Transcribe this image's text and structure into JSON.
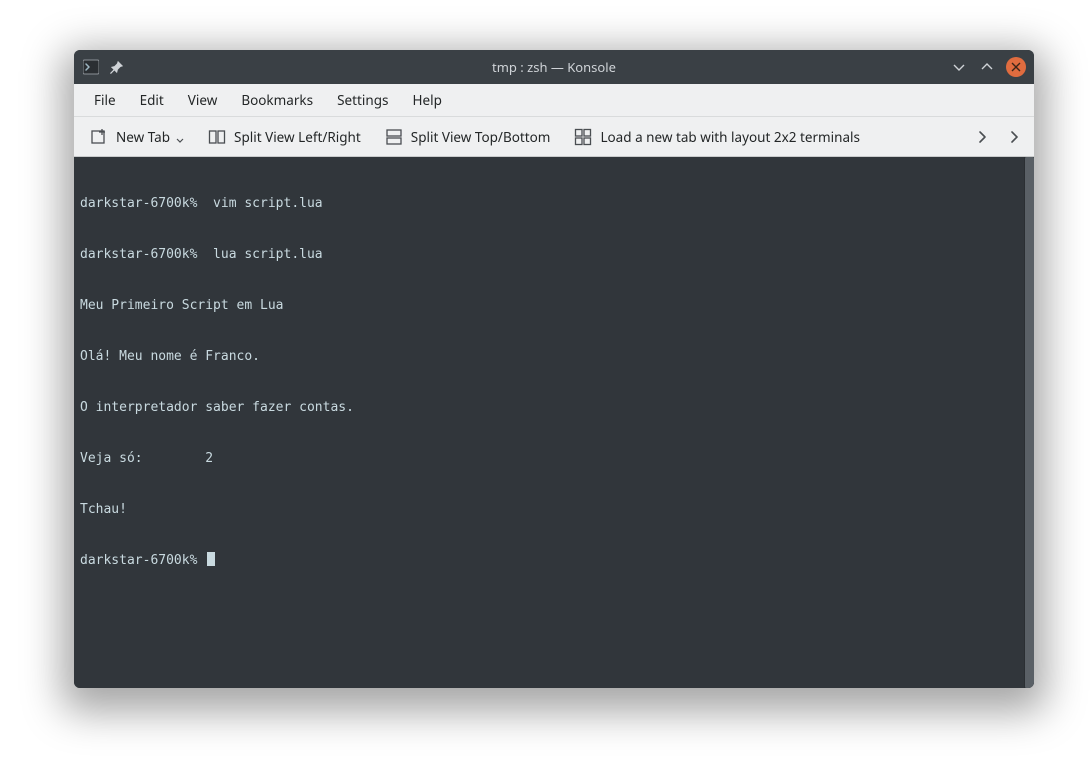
{
  "window": {
    "title": "tmp : zsh — Konsole"
  },
  "menubar": {
    "items": [
      "File",
      "Edit",
      "View",
      "Bookmarks",
      "Settings",
      "Help"
    ]
  },
  "toolbar": {
    "new_tab": "New Tab",
    "split_lr": "Split View Left/Right",
    "split_tb": "Split View Top/Bottom",
    "load_layout": "Load a new tab with layout 2x2 terminals"
  },
  "terminal": {
    "lines": [
      "darkstar-6700k%  vim script.lua",
      "darkstar-6700k%  lua script.lua",
      "Meu Primeiro Script em Lua",
      "Olá! Meu nome é Franco.",
      "O interpretador saber fazer contas.",
      "Veja só:        2",
      "Tchau!",
      "darkstar-6700k% "
    ]
  }
}
